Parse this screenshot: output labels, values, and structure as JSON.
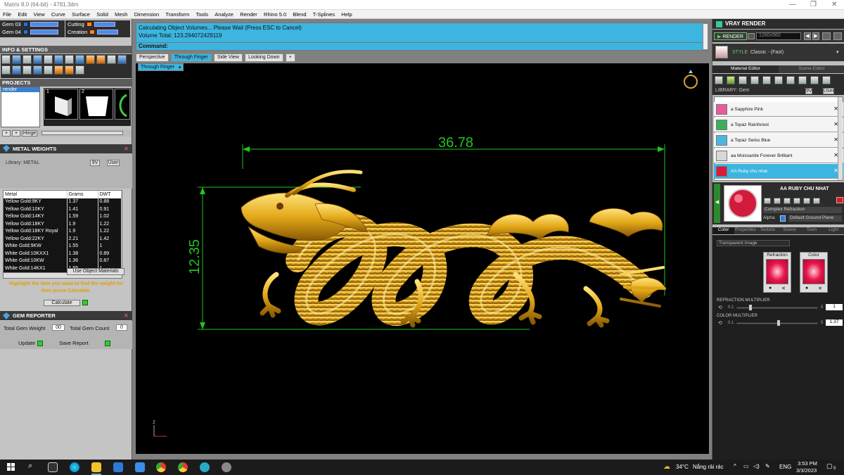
{
  "window": {
    "title": "Matrix 8.0 (64-bit) - 4781.3dm",
    "controls": [
      "—",
      "❐",
      "✕"
    ]
  },
  "menu": [
    "File",
    "Edit",
    "View",
    "Curve",
    "Surface",
    "Solid",
    "Mesh",
    "Dimension",
    "Transform",
    "Tools",
    "Analyze",
    "Render",
    "Rhino 5.0",
    "Blend",
    "T-Splines",
    "Help"
  ],
  "left_panel": {
    "gem_rows": [
      "Gem 03",
      "Gem 04"
    ],
    "cutting_rows": [
      "Cutting",
      "Creation"
    ],
    "info_header": "INFO & SETTINGS",
    "projects_header": "PROJECTS",
    "project_item": "render",
    "thumb_numbers": [
      "1",
      "2"
    ],
    "hinge_btn": "Hinge",
    "metal_weights": {
      "header": "METAL WEIGHTS",
      "library_label": "Library: METAL",
      "toggle_9v": "9V",
      "toggle_user": "User",
      "columns": [
        "Metal",
        "Grams",
        "DWT"
      ],
      "rows": [
        [
          "Yellow Gold:9KY",
          "1.37",
          "0.88"
        ],
        [
          "Yellow Gold:10KY",
          "1.41",
          "0.91"
        ],
        [
          "Yellow Gold:14KY",
          "1.59",
          "1.02"
        ],
        [
          "Yellow Gold:18KY",
          "1.9",
          "1.22"
        ],
        [
          "Yellow Gold:18KY Royal",
          "1.9",
          "1.22"
        ],
        [
          "Yellow Gold:22KY",
          "2.21",
          "1.42"
        ],
        [
          "White Gold:9KW",
          "1.55",
          "1"
        ],
        [
          "White Gold:10KXX1",
          "1.38",
          "0.89"
        ],
        [
          "White Gold:10KW",
          "1.36",
          "0.87"
        ],
        [
          "White Gold:14KX1",
          "1.55",
          "1"
        ]
      ],
      "use_object_materials": "Use Object Materials",
      "hint": "Highlight the item you want to find the weight for then press Calculate.",
      "calculate": "Calculate"
    },
    "gem_reporter": {
      "header": "GEM REPORTER",
      "total_weight_label": "Total Gem Weight",
      "total_weight_value": "00",
      "total_count_label": "Total Gem Count",
      "total_count_value": "0",
      "update": "Update",
      "save_report": "Save Report"
    }
  },
  "command": {
    "line1": "Calculating Object Volumes... Please Wait (Press ESC to Cancel)",
    "line2": "Volume Total: 123.294072429119",
    "label": "Command:"
  },
  "viewport_tabs": [
    "Perspective",
    "Through Finger",
    "Side View",
    "Looking Down"
  ],
  "active_view": "Through Finger",
  "viewport": {
    "dim_width": "36.78",
    "dim_height": "12.35",
    "axis_label": "z"
  },
  "right_panel": {
    "header": "VRAY RENDER",
    "render_btn": "RENDER",
    "resolution": "1280x960",
    "style_label": "STYLE",
    "style_value": "Classic - (Fast)",
    "editor_tabs": [
      "Material Editor",
      "Scene Editor"
    ],
    "library_label": "LIBRARY: Gem",
    "toggle_9v": "9V",
    "toggle_user": "User",
    "materials": [
      {
        "name": "a Sapphire Pink",
        "color": "#e85a9a"
      },
      {
        "name": "a Topaz Rainforest",
        "color": "#3fae5c"
      },
      {
        "name": "a Topaz Swiss Blue",
        "color": "#49b8e0"
      },
      {
        "name": "aa Moissanite Forever Brilliant",
        "color": "#d8d8d8"
      },
      {
        "name": "AA Ruby chu nhat",
        "color": "#d61a3c"
      }
    ],
    "selected_name": "AA RUBY CHU NHAT",
    "complex_refraction": "Complex Refraction",
    "alpha_label": "Alpha",
    "ground_plane": "Default Ground Plane",
    "prop_tabs": [
      "Color",
      "Properties",
      "Texture",
      "Scene",
      "Toon",
      "Light"
    ],
    "transparent_image": "Transparent Image",
    "refraction_label": "Refraction",
    "color_label": "Color",
    "refraction_multiplier_label": "REFRACTION MULTIPLIER",
    "refraction_min": "0.1",
    "refraction_max": "5",
    "refraction_value": "1",
    "color_multiplier_label": "COLOR MULTIPLIER",
    "color_min": "0.1",
    "color_max": "5",
    "color_value": "1.37"
  },
  "taskbar": {
    "weather": "34°C",
    "weather_text": "Nắng rải rác",
    "lang": "ENG",
    "time": "3:53 PM",
    "date": "3/3/2023",
    "notif_count": "5"
  }
}
